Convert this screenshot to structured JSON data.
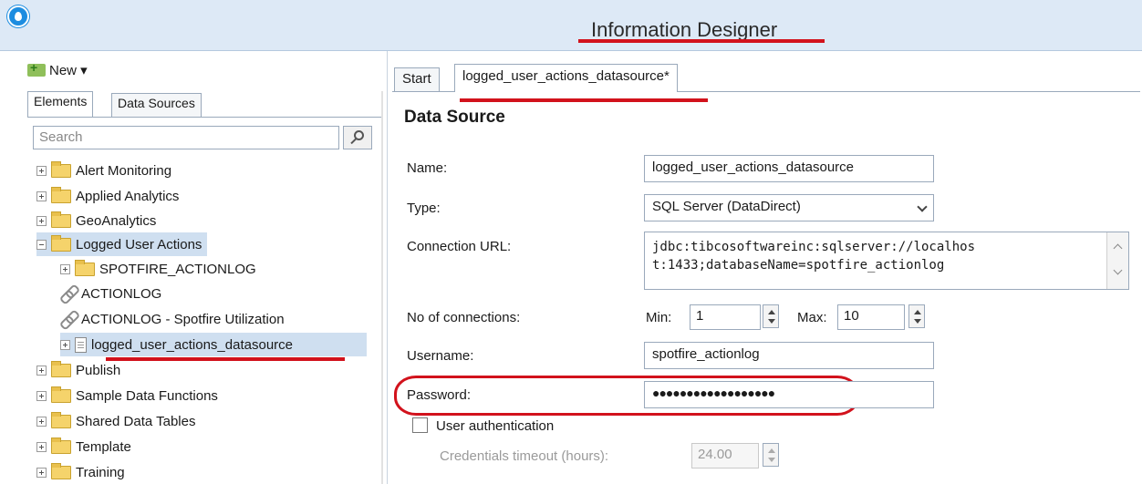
{
  "window": {
    "title": "Information Designer"
  },
  "toolbar": {
    "new_label": "New ▾"
  },
  "left": {
    "tabs": [
      "Elements",
      "Data Sources"
    ],
    "search_placeholder": "Search",
    "tree": [
      {
        "label": "Alert Monitoring",
        "type": "folder"
      },
      {
        "label": "Applied Analytics",
        "type": "folder"
      },
      {
        "label": "GeoAnalytics",
        "type": "folder"
      },
      {
        "label": "Logged User Actions",
        "type": "folder",
        "expanded": true,
        "selected": true
      },
      {
        "label": "SPOTFIRE_ACTIONLOG",
        "type": "folder"
      },
      {
        "label": "ACTIONLOG",
        "type": "link"
      },
      {
        "label": "ACTIONLOG - Spotfire Utilization",
        "type": "link"
      },
      {
        "label": "logged_user_actions_datasource",
        "type": "datasource",
        "selected": true
      },
      {
        "label": "Publish",
        "type": "folder"
      },
      {
        "label": "Sample Data Functions",
        "type": "folder"
      },
      {
        "label": "Shared Data Tables",
        "type": "folder"
      },
      {
        "label": "Template",
        "type": "folder"
      },
      {
        "label": "Training",
        "type": "folder"
      }
    ]
  },
  "right": {
    "tabs": [
      "Start",
      "logged_user_actions_datasource*"
    ],
    "section_title": "Data Source",
    "form": {
      "name_label": "Name:",
      "name_value": "logged_user_actions_datasource",
      "type_label": "Type:",
      "type_value": "SQL Server (DataDirect)",
      "url_label": "Connection URL:",
      "url_line1": "jdbc:tibcosoftwareinc:sqlserver://localhos",
      "url_line2": "t:1433;databaseName=spotfire_actionlog",
      "connections_label": "No of connections:",
      "min_label": "Min:",
      "min_value": "1",
      "max_label": "Max:",
      "max_value": "10",
      "username_label": "Username:",
      "username_value": "spotfire_actionlog",
      "password_label": "Password:",
      "password_value": "●●●●●●●●●●●●●●●●●●",
      "user_auth_label": "User authentication",
      "user_auth_checked": false,
      "timeout_label": "Credentials timeout (hours):",
      "timeout_value": "24.00"
    }
  },
  "colors": {
    "annotation_red": "#d2121c",
    "selection": "#cfdff0",
    "titlebar": "#dde9f6"
  }
}
